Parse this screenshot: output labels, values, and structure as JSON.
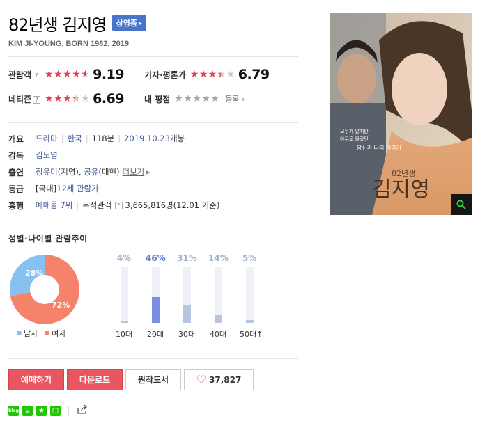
{
  "movie": {
    "title": "82년생 김지영",
    "status_badge": "상영중",
    "english_title": "KIM JI-YOUNG, BORN 1982, 2019"
  },
  "ratings": {
    "audience": {
      "label": "관람객",
      "score": "9.19",
      "stars_fraction": 0.919
    },
    "critic": {
      "label": "기자·평론가",
      "score": "6.79",
      "stars_fraction": 0.679
    },
    "netizen": {
      "label": "네티즌",
      "score": "6.69",
      "stars_fraction": 0.669
    },
    "my_rating": {
      "label": "내 평점",
      "register_label": "등록"
    }
  },
  "info": {
    "overview_label": "개요",
    "genre": "드라마",
    "country": "한국",
    "runtime": "118분",
    "release_date": "2019.10.23",
    "release_suffix": "개봉",
    "director_label": "감독",
    "director": "김도영",
    "cast_label": "출연",
    "cast_1": "정유미",
    "cast_1_role": "(지영)",
    "cast_2": "공유",
    "cast_2_role": "(대현)",
    "more_label": "더보기",
    "grade_label": "등급",
    "grade_prefix": "[국내]",
    "grade": "12세 관람가",
    "boxoffice_label": "흥행",
    "rank": "예매율 7위",
    "cumulative_label": "누적관객",
    "cumulative_value": "3,665,816명(12.01 기준)"
  },
  "trend": {
    "title": "성별·나이별 관람추이",
    "gender": {
      "male_label": "남자",
      "female_label": "여자",
      "male_pct": 28,
      "female_pct": 72,
      "male_text": "28%",
      "female_text": "72%",
      "male_color": "#86c1f2",
      "female_color": "#f5826a"
    },
    "ages": [
      {
        "label": "10대",
        "pct": 4,
        "text": "4%"
      },
      {
        "label": "20대",
        "pct": 46,
        "text": "46%"
      },
      {
        "label": "30대",
        "pct": 31,
        "text": "31%"
      },
      {
        "label": "40대",
        "pct": 14,
        "text": "14%"
      },
      {
        "label": "50대↑",
        "pct": 5,
        "text": "5%"
      }
    ]
  },
  "actions": {
    "book_label": "예매하기",
    "download_label": "다운로드",
    "book_original_label": "원작도서",
    "like_count": "37,827"
  },
  "share": {
    "icons": [
      "blog-icon",
      "cafe-icon",
      "bookmark-star-icon",
      "memo-icon",
      "share-icon"
    ]
  },
  "poster": {
    "tagline_1": "모두가 알지만",
    "tagline_2": "아무도 몰랐던",
    "tagline_3": "당신과 나의 이야기",
    "poster_title_small": "82년생",
    "poster_title_large": "김지영"
  }
}
